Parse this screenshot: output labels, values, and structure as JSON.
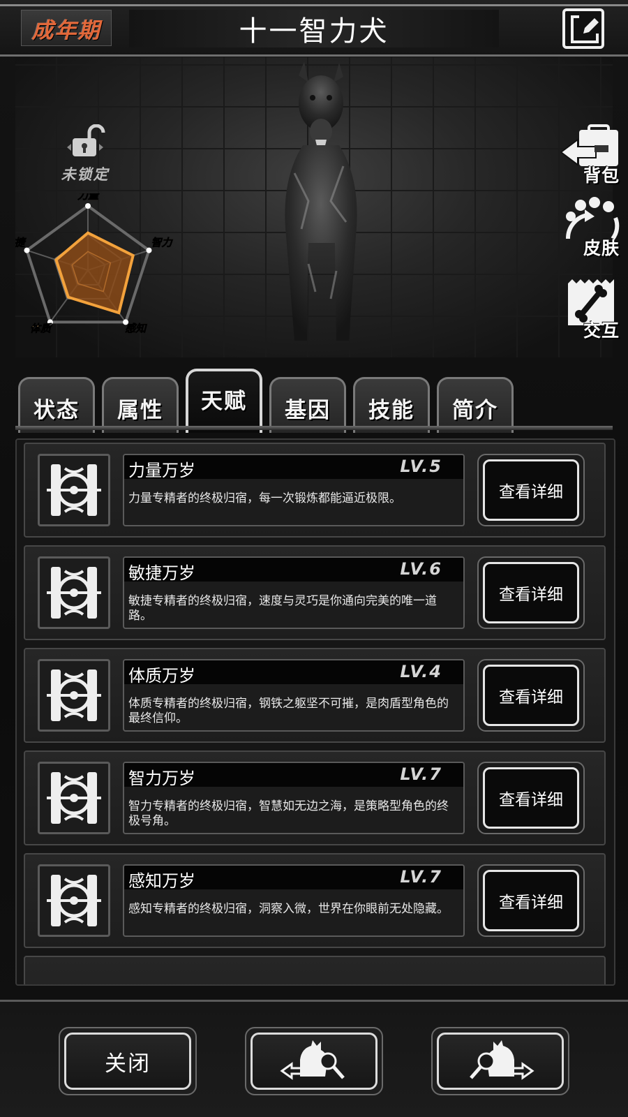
{
  "header": {
    "stage": "成年期",
    "title": "十一智力犬"
  },
  "showcase": {
    "lock_label": "未锁定",
    "radar": {
      "axes": [
        "力量",
        "智力",
        "感知",
        "体质",
        "敏捷"
      ]
    },
    "side_buttons": [
      {
        "label": "背包",
        "icon": "backpack-icon"
      },
      {
        "label": "皮肤",
        "icon": "paw-skin-icon"
      },
      {
        "label": "交互",
        "icon": "bone-interact-icon"
      }
    ]
  },
  "tabs": [
    {
      "label": "状态",
      "active": false
    },
    {
      "label": "属性",
      "active": false
    },
    {
      "label": "天赋",
      "active": true
    },
    {
      "label": "基因",
      "active": false
    },
    {
      "label": "技能",
      "active": false
    },
    {
      "label": "简介",
      "active": false
    }
  ],
  "talents": [
    {
      "name": "力量万岁",
      "level": "LV.5",
      "desc": "力量专精者的终极归宿，每一次锻炼都能逼近极限。",
      "button": "查看详细"
    },
    {
      "name": "敏捷万岁",
      "level": "LV.6",
      "desc": "敏捷专精者的终极归宿，速度与灵巧是你通向完美的唯一道路。",
      "button": "查看详细"
    },
    {
      "name": "体质万岁",
      "level": "LV.4",
      "desc": "体质专精者的终极归宿，钢铁之躯坚不可摧，是肉盾型角色的最终信仰。",
      "button": "查看详细"
    },
    {
      "name": "智力万岁",
      "level": "LV.7",
      "desc": "智力专精者的终极归宿，智慧如无边之海，是策略型角色的终极号角。",
      "button": "查看详细"
    },
    {
      "name": "感知万岁",
      "level": "LV.7",
      "desc": "感知专精者的终极归宿，洞察入微，世界在你眼前无处隐藏。",
      "button": "查看详细"
    }
  ],
  "bottom": {
    "close": "关闭",
    "prev_icon": "prev-pet-search-icon",
    "next_icon": "next-pet-search-icon"
  }
}
